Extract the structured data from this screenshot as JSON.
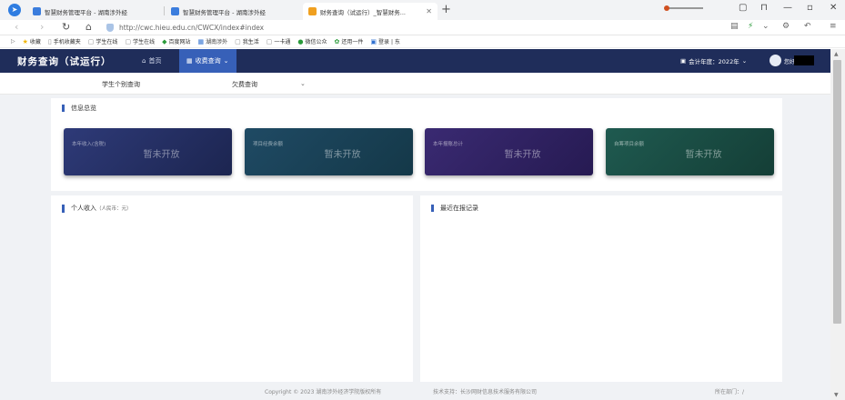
{
  "browser": {
    "tabs": [
      {
        "title": "智慧财务管理平台 - 湖南涉外经"
      },
      {
        "title": "智慧财务管理平台 - 湖南涉外经"
      },
      {
        "title": "财务查询（试运行）_智慧财务..."
      }
    ],
    "url": "http://cwc.hieu.edu.cn/CWCX/index#index",
    "bookmarks": [
      {
        "label": "收藏",
        "icon": "star-icon"
      },
      {
        "label": "手机收藏夹",
        "icon": "phone-icon"
      },
      {
        "label": "学生在线",
        "icon": "page-icon"
      },
      {
        "label": "学生在线",
        "icon": "page-icon"
      },
      {
        "label": "百度网站",
        "icon": "shield-icon"
      },
      {
        "label": "湖南涉外",
        "icon": "image-icon"
      },
      {
        "label": "我生活",
        "icon": "page-icon"
      },
      {
        "label": "一卡通",
        "icon": "page-icon"
      },
      {
        "label": "微信公众",
        "icon": "wechat-icon"
      },
      {
        "label": "还用一件",
        "icon": "gear-icon"
      },
      {
        "label": "登录 | 东",
        "icon": "login-icon"
      }
    ]
  },
  "app": {
    "title": "财务查询（试运行）",
    "menu": [
      {
        "label": "首页",
        "icon": "home-icon"
      },
      {
        "label": "收费查询",
        "icon": "grid-icon"
      }
    ],
    "year_label": "会计年度：2022年",
    "username": "您好",
    "submenu": [
      {
        "label": "学生个别查询"
      },
      {
        "label": "欠费查询"
      }
    ]
  },
  "info_panel": {
    "title": "信息总览",
    "cards": [
      {
        "label": "本年收入(含税)",
        "value": "暂未开放",
        "color_a": "#2e3a78",
        "color_b": "#1c2550"
      },
      {
        "label": "项目经费余额",
        "value": "暂未开放",
        "color_a": "#1f4a64",
        "color_b": "#143848"
      },
      {
        "label": "本年报账总计",
        "value": "暂未开放",
        "color_a": "#3a2a72",
        "color_b": "#261a52"
      },
      {
        "label": "自筹项目余额",
        "value": "暂未开放",
        "color_a": "#1f5a50",
        "color_b": "#143e36"
      }
    ]
  },
  "income_panel": {
    "title": "个人收入",
    "unit": "（人民币：元）"
  },
  "record_panel": {
    "title": "最近在报记录"
  },
  "footer": {
    "copyright": "Copyright © 2023 湖南涉外经济学院版权所有",
    "support": "技术支持：长沙网财信息技术服务有限公司",
    "dept": "所在部门：/"
  }
}
